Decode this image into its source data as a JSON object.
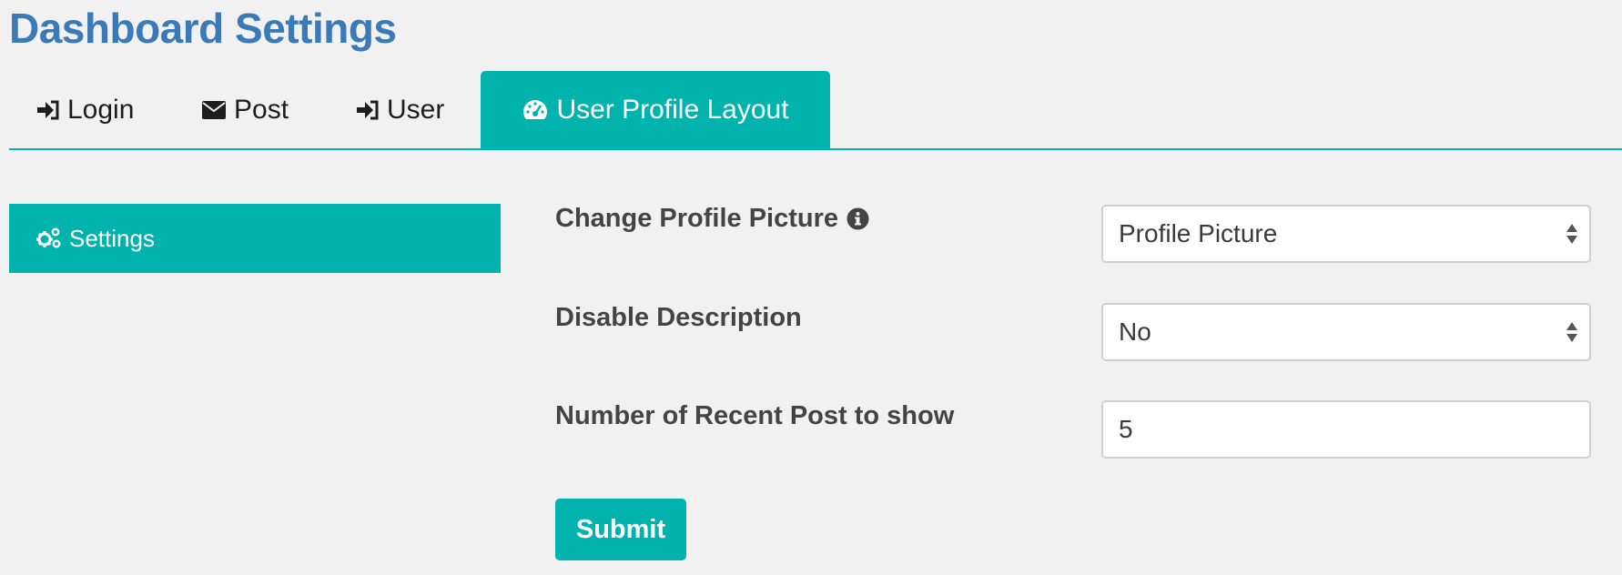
{
  "page": {
    "title": "Dashboard Settings"
  },
  "tabs": [
    {
      "label": "Login",
      "icon": "sign-in-icon",
      "active": false
    },
    {
      "label": "Post",
      "icon": "envelope-icon",
      "active": false
    },
    {
      "label": "User",
      "icon": "sign-in-icon",
      "active": false
    },
    {
      "label": "User Profile Layout",
      "icon": "dashboard-icon",
      "active": true
    }
  ],
  "sidebar": {
    "items": [
      {
        "label": "Settings",
        "icon": "gears-icon",
        "active": true
      }
    ]
  },
  "form": {
    "change_profile_picture": {
      "label": "Change Profile Picture",
      "value": "Profile Picture",
      "info_icon": "info-circle-icon"
    },
    "disable_description": {
      "label": "Disable Description",
      "value": "No"
    },
    "recent_posts": {
      "label": "Number of Recent Post to show",
      "value": "5"
    },
    "submit_label": "Submit"
  },
  "colors": {
    "accent": "#00b4ad",
    "title": "#3a7ab8",
    "background": "#f1f1f1"
  }
}
